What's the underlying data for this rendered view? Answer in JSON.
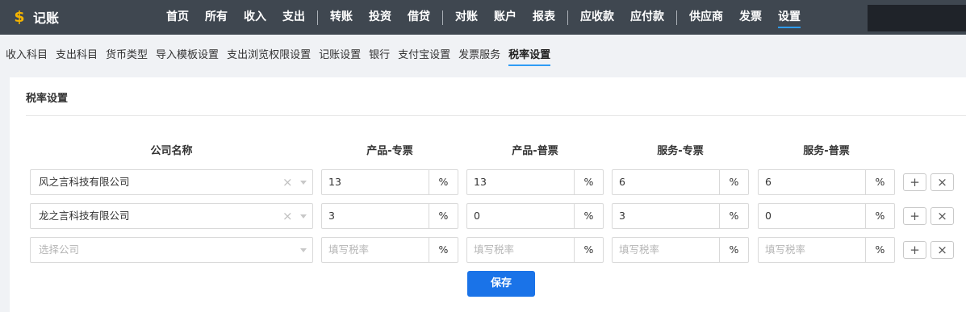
{
  "app": {
    "name": "记账",
    "logo_icon": "dollar-coin-icon",
    "logo_color": "#f5b400"
  },
  "nav": {
    "items": [
      "首页",
      "所有",
      "收入",
      "支出",
      "转账",
      "投资",
      "借贷",
      "对账",
      "账户",
      "报表",
      "应收款",
      "应付款",
      "供应商",
      "发票",
      "设置"
    ],
    "active": "设置",
    "accent": "#2e9cf5"
  },
  "subnav": {
    "items": [
      "收入科目",
      "支出科目",
      "货币类型",
      "导入模板设置",
      "支出浏览权限设置",
      "记账设置",
      "银行",
      "支付宝设置",
      "发票服务",
      "税率设置"
    ],
    "active": "税率设置"
  },
  "card": {
    "title": "税率设置",
    "headers": {
      "company": "公司名称",
      "product_special": "产品-专票",
      "product_normal": "产品-普票",
      "service_special": "服务-专票",
      "service_normal": "服务-普票"
    },
    "rows": [
      {
        "company": "风之言科技有限公司",
        "rates": [
          "13",
          "13",
          "6",
          "6"
        ]
      },
      {
        "company": "龙之言科技有限公司",
        "rates": [
          "3",
          "0",
          "3",
          "0"
        ]
      }
    ],
    "new_row": {
      "company_placeholder": "选择公司",
      "rate_placeholder": "填写税率"
    },
    "unit": "%",
    "add_symbol": "+",
    "remove_symbol": "×",
    "clear_symbol": "×",
    "save_label": "保存",
    "save_color": "#1a73e8"
  }
}
